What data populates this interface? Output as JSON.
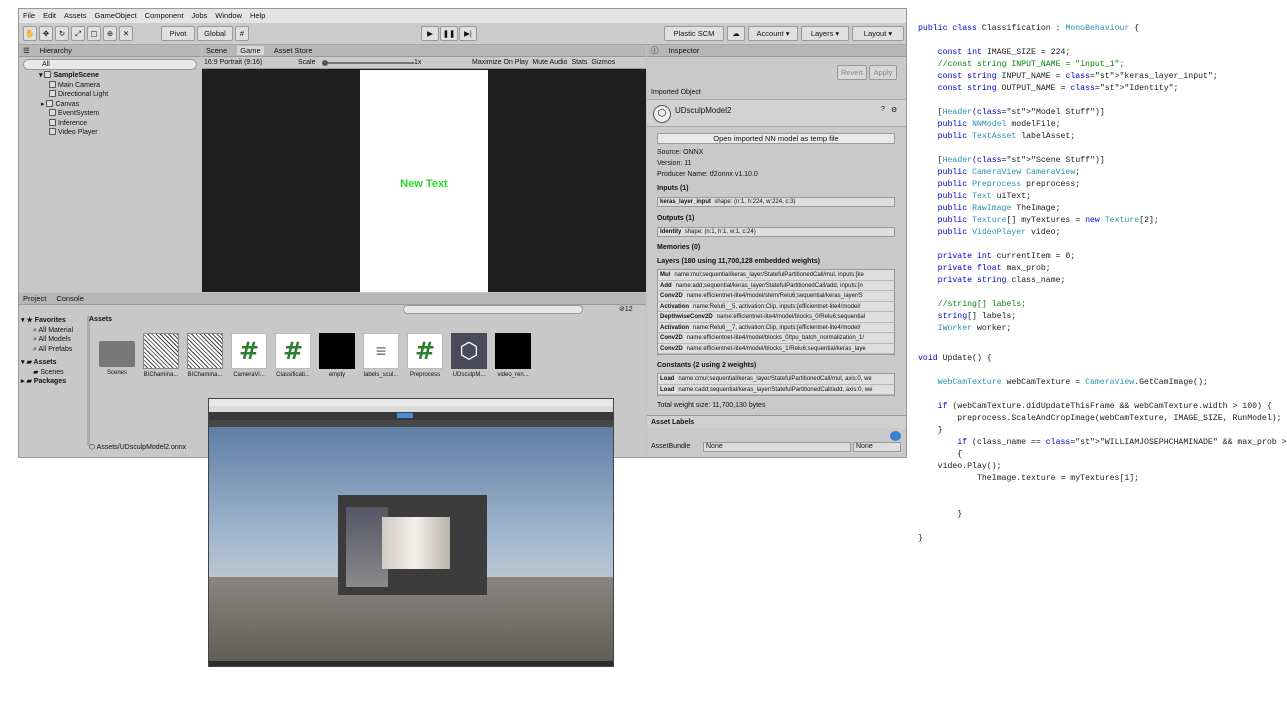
{
  "menu": [
    "File",
    "Edit",
    "Assets",
    "GameObject",
    "Component",
    "Jobs",
    "Window",
    "Help"
  ],
  "toolbar": {
    "pivot": "Pivot",
    "global": "Global",
    "plastic": "Plastic SCM",
    "account": "Account",
    "layers": "Layers",
    "layout": "Layout"
  },
  "hierarchy": {
    "tab": "Hierarchy",
    "search": "All",
    "scene": "SampleScene",
    "items": [
      "Main Camera",
      "Directional Light",
      "Canvas",
      "EventSystem",
      "Inference",
      "Video Player"
    ]
  },
  "game": {
    "tabs": [
      "Scene",
      "Game",
      "Asset Store"
    ],
    "display": "16:9 Portrait (9:16)",
    "scale_label": "Scale",
    "scale_value": "1x",
    "options": [
      "Maximize On Play",
      "Mute Audio",
      "Stats",
      "Gizmos"
    ],
    "canvas_text": "New Text"
  },
  "project": {
    "tabs": [
      "Project",
      "Console"
    ],
    "favorites": "Favorites",
    "fav_items": [
      "All Material",
      "All Models",
      "All Prefabs"
    ],
    "assets_root": "Assets",
    "tree": [
      "Scenes",
      "Packages"
    ],
    "header": "Assets",
    "count": "12",
    "footer": "Assets/UDsculpModel2.onnx",
    "assets": [
      "Scenes",
      "BIChamina...",
      "BIChamina...",
      "CameraVi...",
      "Classificati...",
      "empty",
      "labels_scul...",
      "Preprocess",
      "UDsculpM...",
      "video_ren..."
    ]
  },
  "inspector": {
    "tab": "Inspector",
    "revert": "Revert",
    "apply": "Apply",
    "imported": "Imported Object",
    "model": "UDsculpModel2",
    "open_btn": "Open imported NN model as temp file",
    "source": "Source: ONNX",
    "version": "Version: 11",
    "producer": "Producer Name: tf2onnx v1.10.0",
    "inputs_h": "Inputs (1)",
    "input_name": "keras_layer_input",
    "input_shape": "shape: (n:1, h:224, w:224, c:3)",
    "outputs_h": "Outputs (1)",
    "output_name": "Identity",
    "output_shape": "shape: (n:1, h:1, w:1, c:24)",
    "memories": "Memories (0)",
    "layers_h": "Layers (180 using 11,700,128 embedded weights)",
    "layers": [
      [
        "Mul",
        "name:mul;sequential/keras_layer/StatefulPartitionedCall/mul, inputs:[ke"
      ],
      [
        "Add",
        "name:add;sequential/keras_layer/StatefulPartitionedCall/add, inputs:[n"
      ],
      [
        "Conv2D",
        "name:efficientnet-lite4/model/stem/Relu6;sequential/keras_layer/S"
      ],
      [
        "Activation",
        "name:Relu6__5, activation:Clip, inputs:[efficientnet-lite4/model/"
      ],
      [
        "DepthwiseConv2D",
        "name:efficientnet-lite4/model/blocks_0/Relu6;sequential"
      ],
      [
        "Activation",
        "name:Relu6__7, activation:Clip, inputs:[efficientnet-lite4/model/"
      ],
      [
        "Conv2D",
        "name:efficientnet-lite4/model/blocks_0/tpu_batch_normalization_1/"
      ],
      [
        "Conv2D",
        "name:efficientnet-lite4/model/blocks_1/Relu6;sequential/keras_laye"
      ]
    ],
    "constants_h": "Constants (2 using 2 weights)",
    "constants": [
      [
        "Load",
        "name:cmul;sequential/keras_layer/StatefulPartitionedCall/mul, axis:0, we"
      ],
      [
        "Load",
        "name:cadd;sequential/keras_layer/StatefulPartitionedCall/add, axis:0, we"
      ]
    ],
    "total": "Total weight size: 11,700,130 bytes",
    "labels": "Asset Labels",
    "bundle": "AssetBundle",
    "bundle_val": "None",
    "variant_val": "None"
  },
  "code": [
    "public class Classification : MonoBehaviour {",
    "",
    "    const int IMAGE_SIZE = 224;",
    "    //const string INPUT_NAME = \"input_1\";",
    "    const string INPUT_NAME = \"keras_layer_input\";",
    "    const string OUTPUT_NAME = \"Identity\";",
    "",
    "    [Header(\"Model Stuff\")]",
    "    public NNModel modelFile;",
    "    public TextAsset labelAsset;",
    "",
    "    [Header(\"Scene Stuff\")]",
    "    public CameraView CameraView;",
    "    public Preprocess preprocess;",
    "    public Text uiText;",
    "    public RawImage TheImage;",
    "    public Texture[] myTextures = new Texture[2];",
    "    public VideoPlayer video;",
    "",
    "    private int currentItem = 0;",
    "    private float max_prob;",
    "    private string class_name;",
    "",
    "    //string[] labels;",
    "    string[] labels;",
    "    IWorker worker;",
    "",
    "void Update() {",
    "",
    "    WebCamTexture webCamTexture = CameraView.GetCamImage();",
    "",
    "    if (webCamTexture.didUpdateThisFrame && webCamTexture.width > 100) {",
    "        preprocess.ScaleAndCropImage(webCamTexture, IMAGE_SIZE, RunModel);",
    "    }",
    "        if (class_name == \"WILLIAMJOSEPHCHAMINADE\" && max_prob > 0.9)",
    "        {",
    "    video.Play();",
    "            TheImage.texture = myTextures[1];",
    "",
    "",
    "        }",
    "",
    "}"
  ]
}
